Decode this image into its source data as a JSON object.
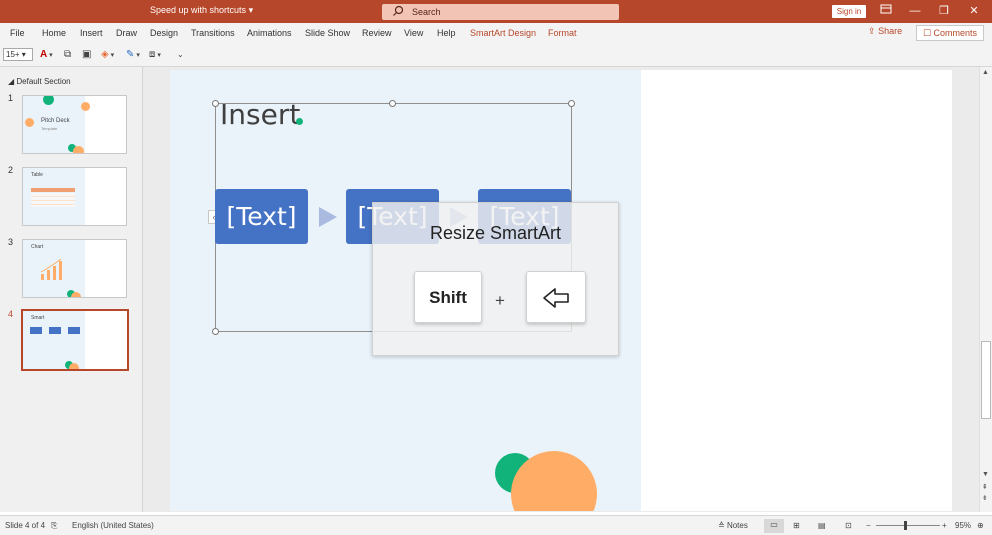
{
  "titlebar": {
    "quick_access": "Speed up with shortcuts",
    "search_placeholder": "Search",
    "signin_label": "Sign in",
    "ribbon_display_icon": "ribbon-display-icon",
    "minimize": "—",
    "restore": "❐",
    "close": "✕"
  },
  "tabs": [
    {
      "label": "File"
    },
    {
      "label": "Home"
    },
    {
      "label": "Insert"
    },
    {
      "label": "Draw"
    },
    {
      "label": "Design"
    },
    {
      "label": "Transitions"
    },
    {
      "label": "Animations"
    },
    {
      "label": "Slide Show"
    },
    {
      "label": "Review"
    },
    {
      "label": "View"
    },
    {
      "label": "Help"
    },
    {
      "label": "SmartArt Design"
    },
    {
      "label": "Format"
    }
  ],
  "share_label": "Share",
  "comments_label": "Comments",
  "toolbar": {
    "font_size": "15+"
  },
  "leftpane": {
    "section_label": "Default Section",
    "slides": [
      {
        "number": "1",
        "title": "Pitch Deck",
        "subtitle": "Template"
      },
      {
        "number": "2",
        "title": "Table"
      },
      {
        "number": "3",
        "title": "Chart"
      },
      {
        "number": "4",
        "title": "Smart"
      }
    ]
  },
  "slide": {
    "title": "Insert",
    "boxes": [
      "[Text]",
      "[Text]",
      "[Text]"
    ]
  },
  "overlay": {
    "label": "Resize SmartArt",
    "key1": "Shift",
    "plus": "+",
    "key2_icon": "left-arrow-key-icon"
  },
  "statusbar": {
    "slide_info": "Slide 4 of 4",
    "language": "English (United States)",
    "notes": "Notes",
    "zoom": "95%"
  },
  "colors": {
    "accent": "#b7472a",
    "smartart_box": "#4472c4",
    "slide_bg": "#eaf3fa",
    "green_dot": "#11b37b",
    "orange_dot": "#ffad66"
  }
}
